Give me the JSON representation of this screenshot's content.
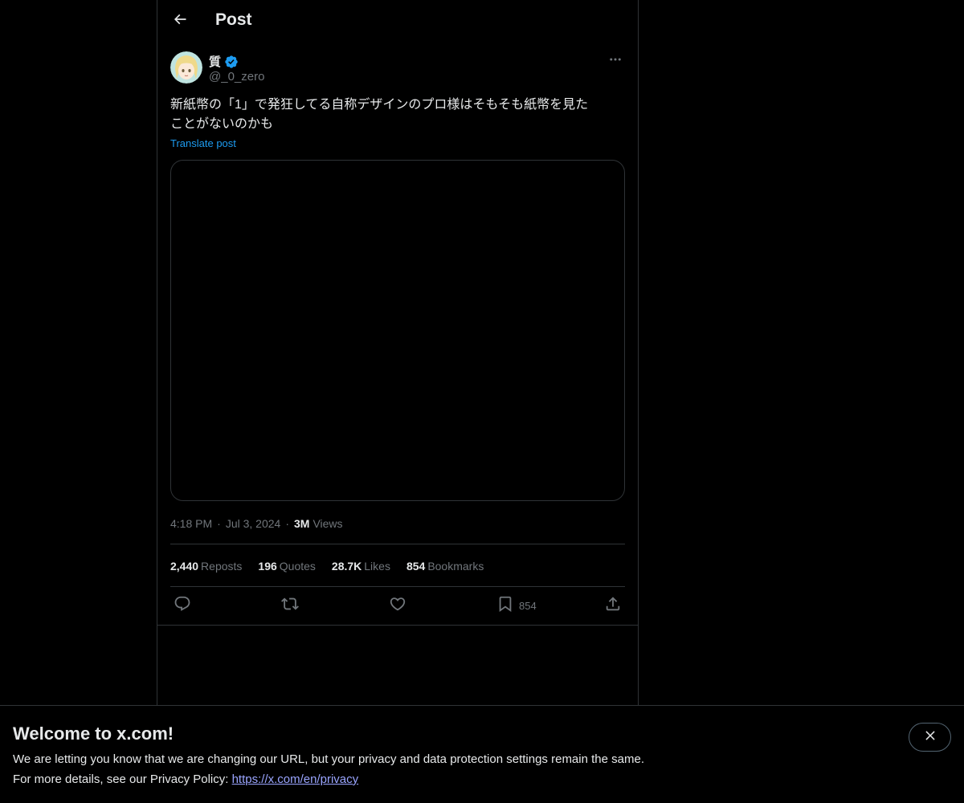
{
  "header": {
    "title": "Post",
    "back_icon": "arrow-left-icon"
  },
  "author": {
    "display_name": "質",
    "handle": "@_0_zero",
    "verified": true,
    "verified_color": "#1d9bf0"
  },
  "post": {
    "text_line1": "新紙幣の「1」で発狂してる自称デザインのプロ様はそもそも紙幣を見た",
    "text_line2": "ことがないのかも",
    "translate_label": "Translate post"
  },
  "meta": {
    "time": "4:18 PM",
    "separator": "·",
    "date": "Jul 3, 2024",
    "views_count": "3M",
    "views_label": "Views"
  },
  "stats": [
    {
      "count": "2,440",
      "label": "Reposts"
    },
    {
      "count": "196",
      "label": "Quotes"
    },
    {
      "count": "28.7K",
      "label": "Likes"
    },
    {
      "count": "854",
      "label": "Bookmarks"
    }
  ],
  "actions": {
    "reply_icon": "reply-icon",
    "repost_icon": "repost-icon",
    "like_icon": "heart-icon",
    "bookmark_icon": "bookmark-icon",
    "bookmark_count": "854",
    "share_icon": "share-icon"
  },
  "banner": {
    "title": "Welcome to x.com!",
    "line1": "We are letting you know that we are changing our URL, but your privacy and data protection settings remain the same.",
    "line2_prefix": "For more details, see our Privacy Policy: ",
    "link": "https://x.com/en/privacy",
    "close_icon": "close-icon"
  },
  "colors": {
    "background": "#000000",
    "text": "#e7e9ea",
    "secondary_text": "#71767b",
    "accent": "#1d9bf0",
    "border": "#2f3336"
  }
}
